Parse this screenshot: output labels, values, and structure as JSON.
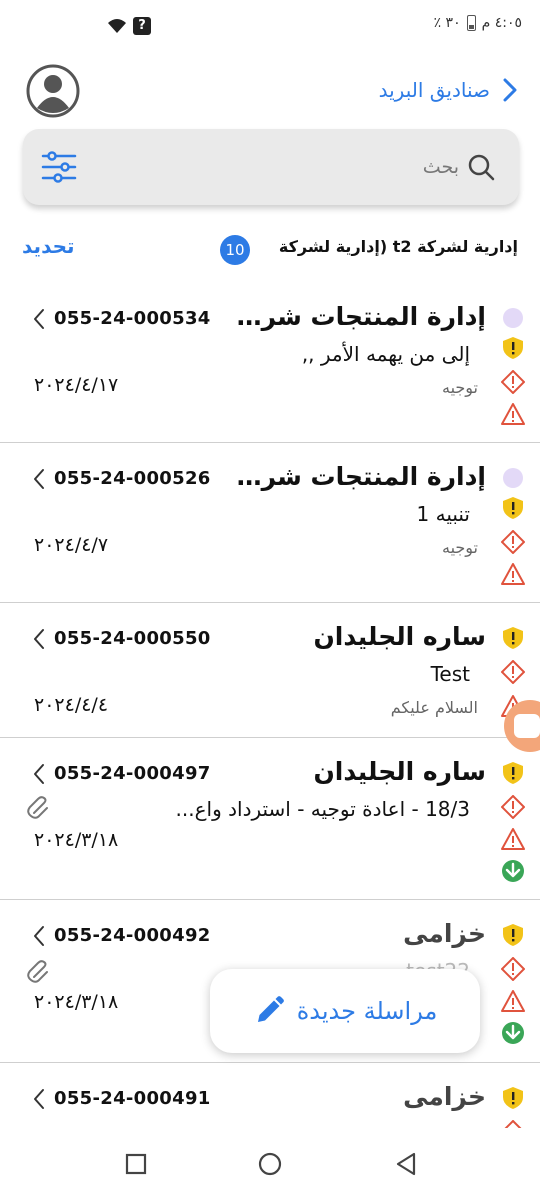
{
  "status_bar": {
    "time": "٤:٠٥ م",
    "battery": "٣٠ ٪"
  },
  "header": {
    "back_label": "صناديق البريد"
  },
  "search": {
    "placeholder": "بحث"
  },
  "company": {
    "name": "إدارية لشركة t2 (إدارية لشركة",
    "count": "10",
    "refresh_label": "تحديد"
  },
  "messages": [
    {
      "number": "055-24-000534",
      "sender": "إدارة المنتجات شرك...",
      "subject": "إلى من يهمه الأمر ,,",
      "preview": "توجيه",
      "date": "٢٠٢٤/٤/١٧"
    },
    {
      "number": "055-24-000526",
      "sender": "إدارة المنتجات شرك...",
      "subject": "تنبيه 1",
      "preview": "توجيه",
      "date": "٢٠٢٤/٤/٧"
    },
    {
      "number": "055-24-000550",
      "sender": "ساره الجليدان",
      "subject": "Test",
      "preview": "السلام عليكم",
      "date": "٢٠٢٤/٤/٤"
    },
    {
      "number": "055-24-000497",
      "sender": "ساره الجليدان",
      "subject": "18/3 - اعادة توجيه - استرداد واع...",
      "preview": "",
      "date": "٢٠٢٤/٣/١٨"
    },
    {
      "number": "055-24-000492",
      "sender": "خزامى",
      "subject": "test22",
      "preview": "",
      "date": "٢٠٢٤/٣/١٨"
    },
    {
      "number": "055-24-000491",
      "sender": "خزامى",
      "subject": "",
      "preview": "",
      "date": ""
    }
  ],
  "fab": {
    "label": "مراسلة جديدة"
  },
  "colors": {
    "accent": "#2d7be5",
    "shield": "#f2c318",
    "alert_red": "#e0533d",
    "download_green": "#3aa657",
    "unread_dot": "#e3d9f7"
  }
}
